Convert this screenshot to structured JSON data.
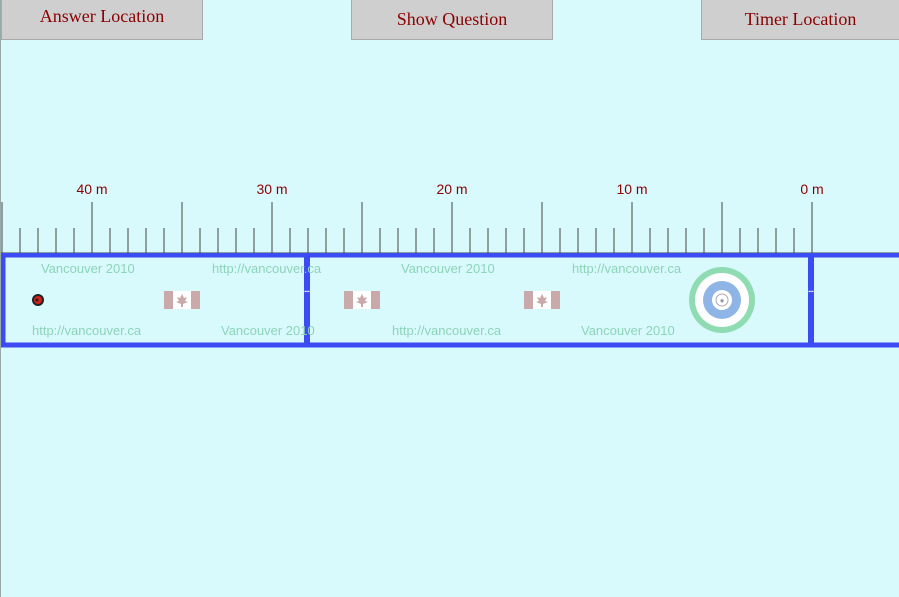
{
  "toolbar": {
    "answer_location_label": "Answer Location",
    "show_question_label": "Show Question",
    "timer_location_label": "Timer Location"
  },
  "ruler": {
    "labels": [
      "40 m",
      "30 m",
      "20 m",
      "10 m",
      "0 m"
    ],
    "marks_m": [
      40,
      30,
      20,
      10,
      0
    ]
  },
  "rink": {
    "watermark_year": "Vancouver 2010",
    "watermark_url": "http://vancouver.ca",
    "stone_position_m": 43
  },
  "colors": {
    "background": "#d9fafd",
    "button_text": "#8b0000",
    "rink_border": "#3b4cf5",
    "house_outer": "#8fdcb2",
    "house_inner": "#8fb4e6",
    "stone": "#d91e1e"
  },
  "icons": [
    "canada-flag-icon",
    "curling-stone-icon",
    "house-target-icon"
  ]
}
